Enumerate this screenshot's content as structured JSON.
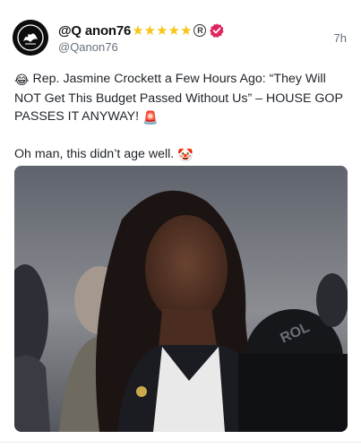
{
  "post": {
    "display_name": "@Q anon76",
    "stars": [
      "★",
      "★",
      "★",
      "★",
      "★"
    ],
    "registered_mark": "R",
    "handle": "@Qanon76",
    "time": "7h",
    "paragraphs": [
      {
        "lead_emoji": "😂",
        "text": "Rep. Jasmine Crockett a Few Hours Ago: “They Will NOT Get This Budget Passed Without Us” – HOUSE GOP PASSES IT ANYWAY!",
        "trail_emoji": "🚨"
      },
      {
        "lead_emoji": "",
        "text": "Oh man, this didn’t age well.",
        "trail_emoji": "🤡"
      }
    ],
    "media": {
      "icon": "photo-media",
      "microphone_text": "ROL"
    }
  },
  "colors": {
    "star": "#f5c518",
    "verified_badge": "#e0245e",
    "secondary_text": "#66707a"
  }
}
